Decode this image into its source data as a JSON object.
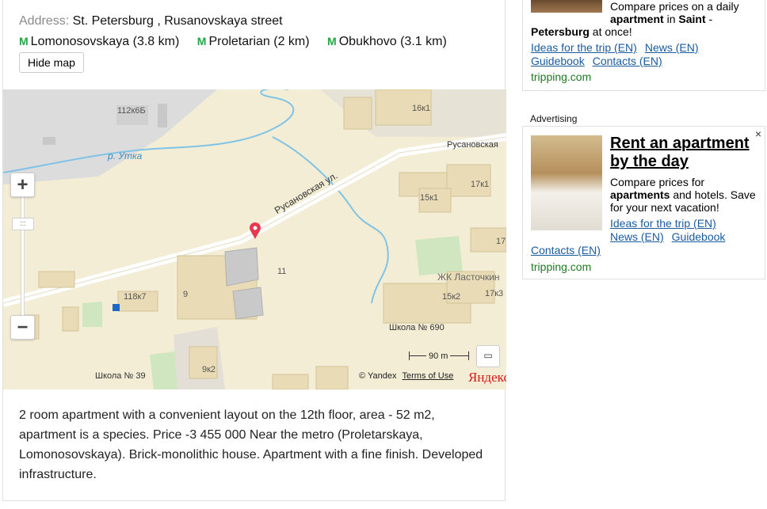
{
  "listing": {
    "address_label": "Address:",
    "address_value": "St. Petersburg , Rusanovskaya street",
    "metro": [
      {
        "name": "Lomonosovskaya (3.8 km)"
      },
      {
        "name": "Proletarian (2 km)"
      },
      {
        "name": "Obukhovo (3.1 km)"
      }
    ],
    "metro_icon": "М",
    "hide_map_label": "Hide map",
    "description": "2 room apartment with a convenient layout on the 12th floor, area - 52 m2, apartment is a species. Price -3 455 000 Near the metro (Proletarskaya, Lomonosovskaya). Brick-monolithic house. Apartment with a fine finish. Developed infrastructure."
  },
  "map": {
    "labels": {
      "b112": "112к6Б",
      "river": "р. Утка",
      "b16": "16к1",
      "street_name": "Русановская",
      "street_ul": "Русановская ул.",
      "b15k1": "15к1",
      "b17k1": "17к1",
      "b17": "17",
      "b11": "11",
      "zhk": "ЖК Ласточкин",
      "b118": "118к7",
      "b9": "9",
      "b15k2": "15к2",
      "b17k3": "17к3",
      "school690": "Школа № 690",
      "b9k2": "9к2",
      "school39": "Школа № 39"
    },
    "zoom_in": "+",
    "zoom_out": "−",
    "slider_grip": ":::",
    "scale": "90 m",
    "copyright": "© Yandex",
    "terms": "Terms of Use",
    "logo": "Яндекс",
    "ruler_icon": "ruler-icon"
  },
  "ad_top": {
    "line1": "Compare prices on a daily",
    "line2_bold": "apartment",
    "line2_mid": " in ",
    "line2_bold2": "Saint",
    "line2_end": " -",
    "line3_bold": "Petersburg",
    "line3_end": " at once!",
    "links": [
      "Ideas for the trip (EN)",
      "News (EN)",
      "Guidebook",
      "Contacts (EN)"
    ],
    "domain": "tripping.com"
  },
  "ad_main": {
    "label": "Advertising",
    "close": "×",
    "title": "Rent an apartment by the day",
    "body_pre": "Compare prices for ",
    "body_bold": "apartments",
    "body_post": " and hotels. Save for your next vacation!",
    "links1": [
      "Ideas for the trip (EN)",
      "News (EN)",
      "Guidebook"
    ],
    "link2": "Contacts (EN)",
    "domain": "tripping.com"
  },
  "colors": {
    "metro": "#21a548",
    "link": "#1a5ba0",
    "domain": "#1f7a1f",
    "map_bg": "#f3edd5",
    "pin": "#e8384f"
  }
}
